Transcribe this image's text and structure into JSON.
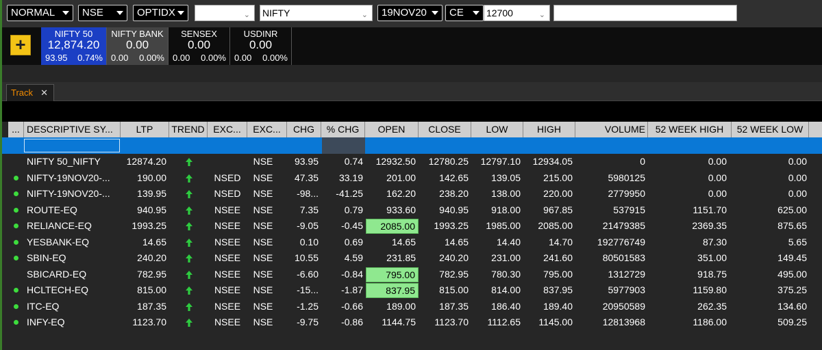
{
  "toolbar": {
    "mode": "NORMAL",
    "exchange": "NSE",
    "instrument": "OPTIDX",
    "blank_field": "",
    "symbol": "NIFTY",
    "expiry": "19NOV20",
    "option_type": "CE",
    "strike": "12700",
    "search": ""
  },
  "indices": [
    {
      "name": "NIFTY 50",
      "price": "12,874.20",
      "change": "93.95",
      "pct": "0.74%"
    },
    {
      "name": "NIFTY BANK",
      "price": "0.00",
      "change": "0.00",
      "pct": "0.00%"
    },
    {
      "name": "SENSEX",
      "price": "0.00",
      "change": "0.00",
      "pct": "0.00%"
    },
    {
      "name": "USDINR",
      "price": "0.00",
      "change": "0.00",
      "pct": "0.00%"
    }
  ],
  "add_button": "+",
  "tab": {
    "label": "Track",
    "close": "✕"
  },
  "headers": [
    "...",
    "DESCRIPTIVE SY...",
    "LTP",
    "TREND",
    "EXC...",
    "EXC...",
    "CHG",
    "% CHG",
    "OPEN",
    "CLOSE",
    "LOW",
    "HIGH",
    "VOLUME",
    "52 WEEK HIGH",
    "52 WEEK LOW"
  ],
  "rows": [
    {
      "dot": false,
      "symbol": "NIFTY 50_NIFTY",
      "ltp": "12874.20",
      "seg": "",
      "exch": "NSE",
      "chg": "93.95",
      "pchg": "0.74",
      "open": "12932.50",
      "close": "12780.25",
      "low": "12797.10",
      "high": "12934.05",
      "volume": "0",
      "wkhigh": "0.00",
      "wklow": "0.00",
      "open_hl": false
    },
    {
      "dot": true,
      "symbol": "NIFTY-19NOV20-...",
      "ltp": "190.00",
      "seg": "NSED",
      "exch": "NSE",
      "chg": "47.35",
      "pchg": "33.19",
      "open": "201.00",
      "close": "142.65",
      "low": "139.05",
      "high": "215.00",
      "volume": "5980125",
      "wkhigh": "0.00",
      "wklow": "0.00",
      "open_hl": false
    },
    {
      "dot": true,
      "symbol": "NIFTY-19NOV20-...",
      "ltp": "139.95",
      "seg": "NSED",
      "exch": "NSE",
      "chg": "-98...",
      "pchg": "-41.25",
      "open": "162.20",
      "close": "238.20",
      "low": "138.00",
      "high": "220.00",
      "volume": "2779950",
      "wkhigh": "0.00",
      "wklow": "0.00",
      "open_hl": false
    },
    {
      "dot": true,
      "symbol": "ROUTE-EQ",
      "ltp": "940.95",
      "seg": "NSEE",
      "exch": "NSE",
      "chg": "7.35",
      "pchg": "0.79",
      "open": "933.60",
      "close": "940.95",
      "low": "918.00",
      "high": "967.85",
      "volume": "537915",
      "wkhigh": "1151.70",
      "wklow": "625.00",
      "open_hl": false
    },
    {
      "dot": true,
      "symbol": "RELIANCE-EQ",
      "ltp": "1993.25",
      "seg": "NSEE",
      "exch": "NSE",
      "chg": "-9.05",
      "pchg": "-0.45",
      "open": "2085.00",
      "close": "1993.25",
      "low": "1985.00",
      "high": "2085.00",
      "volume": "21479385",
      "wkhigh": "2369.35",
      "wklow": "875.65",
      "open_hl": true
    },
    {
      "dot": true,
      "symbol": "YESBANK-EQ",
      "ltp": "14.65",
      "seg": "NSEE",
      "exch": "NSE",
      "chg": "0.10",
      "pchg": "0.69",
      "open": "14.65",
      "close": "14.65",
      "low": "14.40",
      "high": "14.70",
      "volume": "192776749",
      "wkhigh": "87.30",
      "wklow": "5.65",
      "open_hl": false
    },
    {
      "dot": true,
      "symbol": "SBIN-EQ",
      "ltp": "240.20",
      "seg": "NSEE",
      "exch": "NSE",
      "chg": "10.55",
      "pchg": "4.59",
      "open": "231.85",
      "close": "240.20",
      "low": "231.00",
      "high": "241.60",
      "volume": "80501583",
      "wkhigh": "351.00",
      "wklow": "149.45",
      "open_hl": false
    },
    {
      "dot": false,
      "symbol": "SBICARD-EQ",
      "ltp": "782.95",
      "seg": "NSEE",
      "exch": "NSE",
      "chg": "-6.60",
      "pchg": "-0.84",
      "open": "795.00",
      "close": "782.95",
      "low": "780.30",
      "high": "795.00",
      "volume": "1312729",
      "wkhigh": "918.75",
      "wklow": "495.00",
      "open_hl": true
    },
    {
      "dot": true,
      "symbol": "HCLTECH-EQ",
      "ltp": "815.00",
      "seg": "NSEE",
      "exch": "NSE",
      "chg": "-15...",
      "pchg": "-1.87",
      "open": "837.95",
      "close": "815.00",
      "low": "814.00",
      "high": "837.95",
      "volume": "5977903",
      "wkhigh": "1159.80",
      "wklow": "375.25",
      "open_hl": true
    },
    {
      "dot": true,
      "symbol": "ITC-EQ",
      "ltp": "187.35",
      "seg": "NSEE",
      "exch": "NSE",
      "chg": "-1.25",
      "pchg": "-0.66",
      "open": "189.00",
      "close": "187.35",
      "low": "186.40",
      "high": "189.40",
      "volume": "20950589",
      "wkhigh": "262.35",
      "wklow": "134.60",
      "open_hl": false
    },
    {
      "dot": true,
      "symbol": "INFY-EQ",
      "ltp": "1123.70",
      "seg": "NSEE",
      "exch": "NSE",
      "chg": "-9.75",
      "pchg": "-0.86",
      "open": "1144.75",
      "close": "1123.70",
      "low": "1112.65",
      "high": "1145.00",
      "volume": "12813968",
      "wkhigh": "1186.00",
      "wklow": "509.25",
      "open_hl": false
    }
  ],
  "colors": {
    "active_tile": "#1b3fc4",
    "filter_row": "#0a78d6",
    "highlight": "#8fe88f",
    "trend_up": "#2ecc40",
    "tab_text": "#f28b00"
  }
}
